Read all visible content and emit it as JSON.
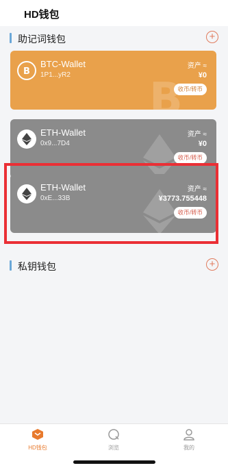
{
  "header": {
    "title": "HD钱包"
  },
  "sections": {
    "mnemonic": {
      "title": "助记词钱包",
      "add_icon": "plus-circle-icon"
    },
    "private_key": {
      "title": "私钥钱包",
      "add_icon": "plus-circle-icon"
    }
  },
  "wallets": [
    {
      "coin": "BTC",
      "name": "BTC-Wallet",
      "address": "1P1...yR2",
      "asset_label": "资产 ≈",
      "asset_value": "¥0",
      "action": "收币/转币",
      "color": "#e9a14b"
    },
    {
      "coin": "ETH",
      "name": "ETH-Wallet",
      "address": "0x9...7D4",
      "asset_label": "资产 ≈",
      "asset_value": "¥0",
      "action": "收币/转币",
      "color": "#8b8b8b"
    },
    {
      "coin": "ETH",
      "name": "ETH-Wallet",
      "address": "0xE...33B",
      "asset_label": "资产 ≈",
      "asset_value": "¥3773.755448",
      "action": "收币/转币",
      "color": "#8b8b8b"
    }
  ],
  "tabs": [
    {
      "label": "HD钱包",
      "icon": "wallet-icon",
      "active": true
    },
    {
      "label": "浏览",
      "icon": "browse-icon",
      "active": false
    },
    {
      "label": "我的",
      "icon": "profile-icon",
      "active": false
    }
  ],
  "colors": {
    "accent": "#e87a2d",
    "highlight": "#ea2f35"
  }
}
